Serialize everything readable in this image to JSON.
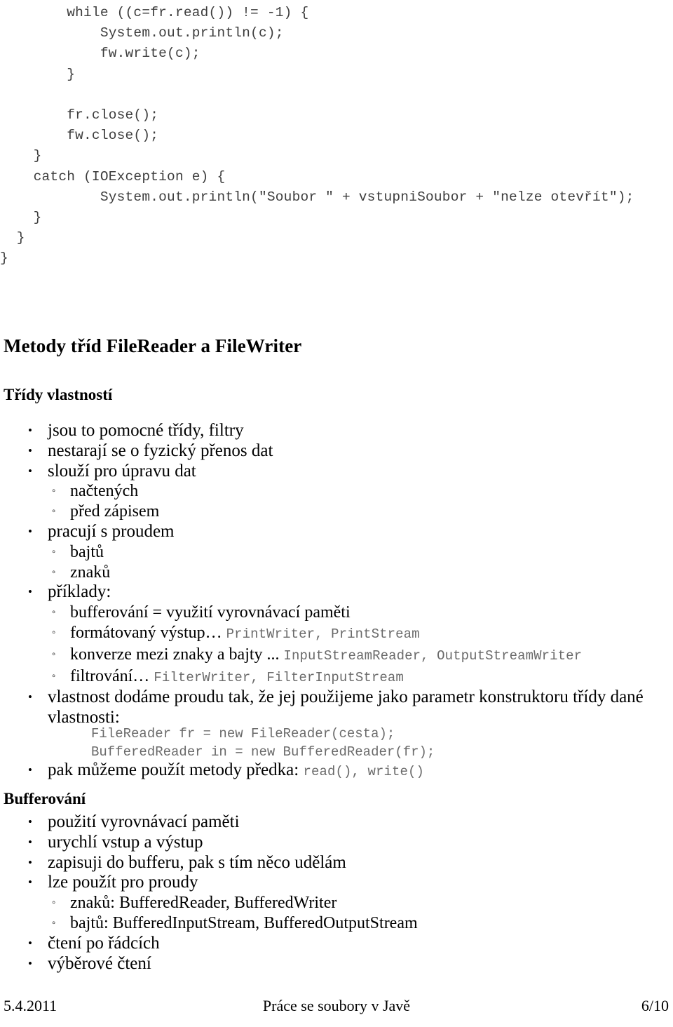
{
  "document": {
    "language": "cs",
    "code_block": {
      "lines": [
        "        while ((c=fr.read()) != -1) {",
        "            System.out.println(c);",
        "            fw.write(c);",
        "        }",
        "",
        "        fr.close();",
        "        fw.close();",
        "    }",
        "    catch (IOException e) {",
        "            System.out.println(\"Soubor \" + vstupniSoubor + \"nelze otevřít\");",
        "    }",
        "  }",
        "}"
      ]
    },
    "heading_main": "Metody tříd FileReader a FileWriter",
    "section_properties": {
      "heading": "Třídy vlastností",
      "items": [
        {
          "level": 1,
          "text": "jsou to pomocné třídy, filtry"
        },
        {
          "level": 1,
          "text": "nestarají se o fyzický přenos dat"
        },
        {
          "level": 1,
          "text": "slouží pro úpravu dat"
        },
        {
          "level": 2,
          "text": "načtených"
        },
        {
          "level": 2,
          "text": "před zápisem"
        },
        {
          "level": 1,
          "text": "pracují s proudem"
        },
        {
          "level": 2,
          "text": "bajtů"
        },
        {
          "level": 2,
          "text": "znaků"
        },
        {
          "level": 1,
          "text": "příklady:"
        },
        {
          "level": 2,
          "text": "bufferování = využití vyrovnávací paměti"
        },
        {
          "level": 2,
          "text": "formátovaný výstup… ",
          "code": "PrintWriter, PrintStream"
        },
        {
          "level": 2,
          "text": "konverze mezi znaky a bajty ... ",
          "code": "InputStreamReader, OutputStreamWriter"
        },
        {
          "level": 2,
          "text": "filtrování… ",
          "code": "FilterWriter, FilterInputStream"
        },
        {
          "level": 1,
          "text": "vlastnost dodáme proudu tak, že jej použijeme jako parametr konstruktoru třídy dané vlastnosti:"
        }
      ],
      "code_sample": [
        "FileReader fr = new FileReader(cesta);",
        "BufferedReader in = new BufferedReader(fr);"
      ],
      "items_after_code": [
        {
          "level": 1,
          "text": "pak můžeme použít metody předka: ",
          "code": "read(), write()"
        }
      ]
    },
    "section_buffering": {
      "heading": "Bufferování",
      "items": [
        {
          "level": 1,
          "text": "použití vyrovnávací paměti"
        },
        {
          "level": 1,
          "text": "urychlí vstup a výstup"
        },
        {
          "level": 1,
          "text": "zapisuji do bufferu, pak s tím něco udělám"
        },
        {
          "level": 1,
          "text": "lze použít pro proudy"
        },
        {
          "level": 2,
          "text": "znaků: BufferedReader, BufferedWriter"
        },
        {
          "level": 2,
          "text": "bajtů: BufferedInputStream, BufferedOutputStream"
        },
        {
          "level": 1,
          "text": "čtení po řádcích"
        },
        {
          "level": 1,
          "text": "výběrové čtení"
        }
      ]
    },
    "footer": {
      "date": "5.4.2011",
      "title": "Práce se soubory v Javě",
      "page": "6/10"
    },
    "markers": {
      "bullet_level1": "•",
      "bullet_level2": "◦"
    }
  }
}
